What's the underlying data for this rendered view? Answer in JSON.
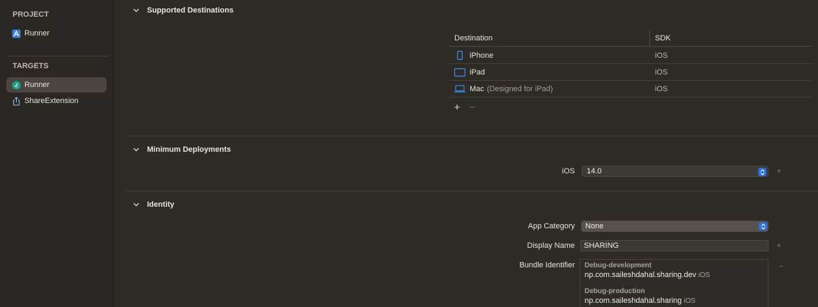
{
  "sidebar": {
    "project_header": "PROJECT",
    "project_items": [
      {
        "label": "Runner",
        "icon": "xcode-project-icon"
      }
    ],
    "targets_header": "TARGETS",
    "target_items": [
      {
        "label": "Runner",
        "icon": "flutter-app-icon",
        "selected": true
      },
      {
        "label": "ShareExtension",
        "icon": "share-extension-icon",
        "selected": false
      }
    ]
  },
  "supported_destinations": {
    "title": "Supported Destinations",
    "columns": [
      "Destination",
      "SDK"
    ],
    "rows": [
      {
        "name": "iPhone",
        "note": "",
        "sdk": "iOS",
        "icon": "iphone-icon"
      },
      {
        "name": "iPad",
        "note": "",
        "sdk": "iOS",
        "icon": "ipad-icon"
      },
      {
        "name": "Mac",
        "note": "(Designed for iPad)",
        "sdk": "iOS",
        "icon": "mac-laptop-icon"
      }
    ],
    "add_symbol": "+",
    "remove_symbol": "−"
  },
  "minimum_deployments": {
    "title": "Minimum Deployments",
    "platform_label": "iOS",
    "version": "14.0",
    "add_symbol": "+"
  },
  "identity": {
    "title": "Identity",
    "app_category_label": "App Category",
    "app_category_value": "None",
    "display_name_label": "Display Name",
    "display_name_value": "SHARING",
    "display_name_action": "+",
    "bundle_identifier_label": "Bundle Identifier",
    "bundle_identifier_action": "→",
    "bundle_identifiers": [
      {
        "config": "Debug-development",
        "value": "np.com.saileshdahal.sharing.dev",
        "platform": "iOS"
      },
      {
        "config": "Debug-production",
        "value": "np.com.saileshdahal.sharing",
        "platform": "iOS"
      }
    ]
  },
  "colors": {
    "background": "#2e2a26",
    "sidebar_selected": "#4a4541",
    "accent_blue": "#2f6ddb"
  }
}
